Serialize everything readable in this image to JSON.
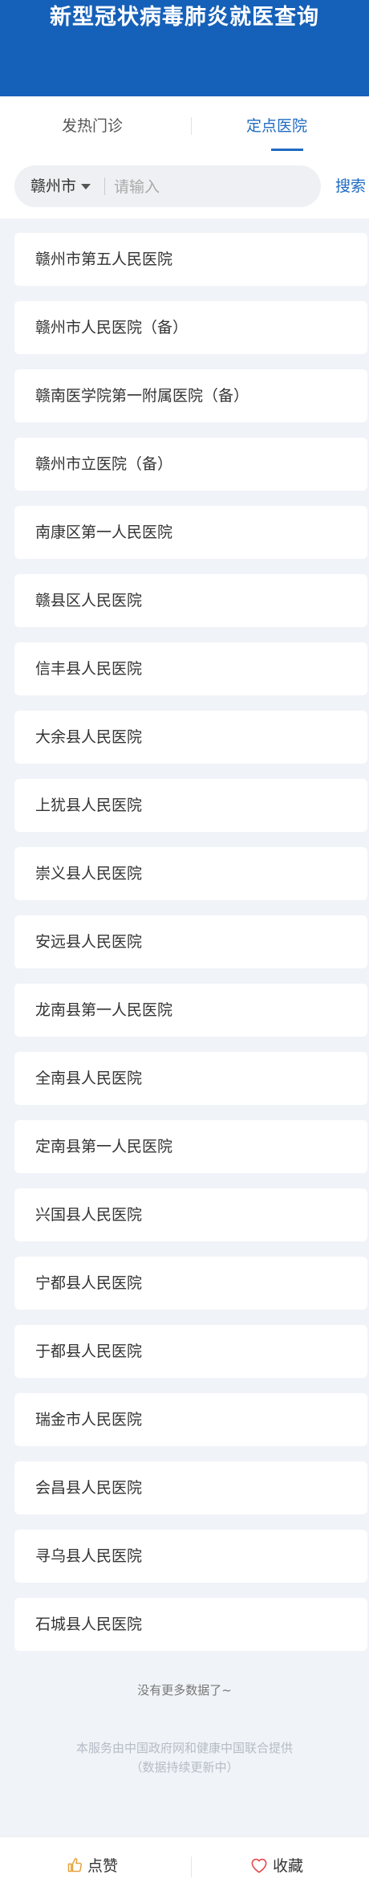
{
  "header": {
    "title": "新型冠状病毒肺炎就医查询"
  },
  "tabs": [
    {
      "label": "发热门诊",
      "active": false
    },
    {
      "label": "定点医院",
      "active": true
    }
  ],
  "search": {
    "city": "赣州市",
    "placeholder": "请输入",
    "button_label": "搜索"
  },
  "hospitals": [
    "赣州市第五人民医院",
    "赣州市人民医院（备）",
    "赣南医学院第一附属医院（备）",
    "赣州市立医院（备）",
    "南康区第一人民医院",
    "赣县区人民医院",
    "信丰县人民医院",
    "大余县人民医院",
    "上犹县人民医院",
    "崇义县人民医院",
    "安远县人民医院",
    "龙南县第一人民医院",
    "全南县人民医院",
    "定南县第一人民医院",
    "兴国县人民医院",
    "宁都县人民医院",
    "于都县人民医院",
    "瑞金市人民医院",
    "会昌县人民医院",
    "寻乌县人民医院",
    "石城县人民医院"
  ],
  "list_end_text": "没有更多数据了~",
  "footer_note": {
    "line1": "本服务由中国政府网和健康中国联合提供",
    "line2": "（数据持续更新中）"
  },
  "bottom_bar": {
    "like_label": "点赞",
    "favorite_label": "收藏"
  },
  "colors": {
    "brand_blue": "#1560b8",
    "active_tab": "#1f6bc1",
    "like_icon": "#e6a23c",
    "favorite_icon": "#e64a4a"
  },
  "icons": {
    "city_dropdown": "caret-down-icon",
    "like": "thumbs-up-icon",
    "favorite": "heart-icon"
  }
}
